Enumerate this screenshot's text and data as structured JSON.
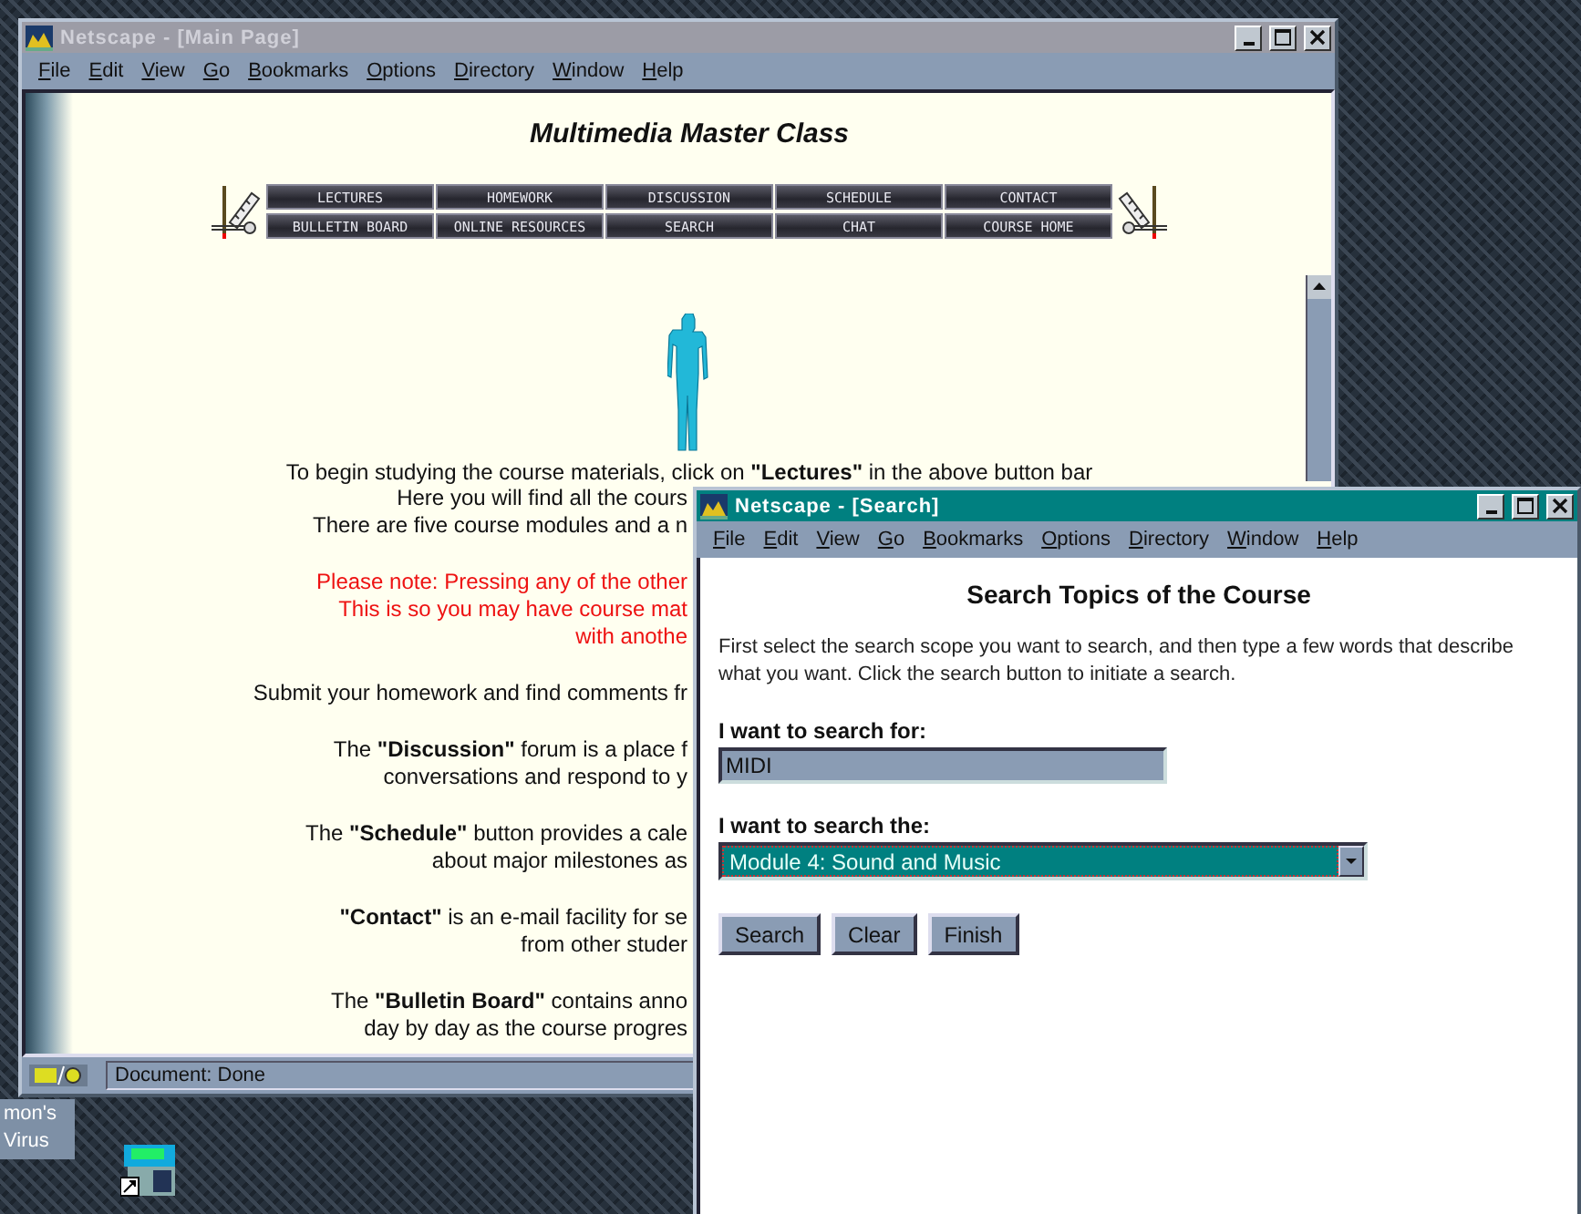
{
  "desktop": {
    "labels": [
      "mon's Virus"
    ]
  },
  "main_window": {
    "title": "Netscape - [Main Page]",
    "active": false,
    "menu": [
      "File",
      "Edit",
      "View",
      "Go",
      "Bookmarks",
      "Options",
      "Directory",
      "Window",
      "Help"
    ],
    "heading": "Multimedia Master Class",
    "nav_buttons": [
      "LECTURES",
      "HOMEWORK",
      "DISCUSSION",
      "SCHEDULE",
      "CONTACT",
      "BULLETIN BOARD",
      "ONLINE RESOURCES",
      "SEARCH",
      "CHAT",
      "COURSE HOME"
    ],
    "intro": "To begin studying the course materials, click on **\"Lectures\"** in the above button bar",
    "paragraphs": [
      {
        "kind": "normal",
        "lines": [
          "Here you will find all the cours",
          "There are five course modules and a n"
        ]
      },
      {
        "kind": "note",
        "lines": [
          "Please note: Pressing any of the other",
          "This is so you may have course mat",
          "with anothe"
        ]
      },
      {
        "kind": "normal",
        "lines": [
          "Submit your homework and find comments fr"
        ]
      },
      {
        "kind": "normal",
        "lines": [
          "The **\"Discussion\"** forum is a place f",
          "conversations and respond to y"
        ]
      },
      {
        "kind": "normal",
        "lines": [
          "The **\"Schedule\"** button provides a cale",
          "about major milestones as"
        ]
      },
      {
        "kind": "normal",
        "lines": [
          "**\"Contact\"** is an e-mail facility for se",
          "from other studer"
        ]
      },
      {
        "kind": "normal",
        "lines": [
          "The **\"Bulletin Board\"** contains anno",
          "day by day as the course progres"
        ]
      }
    ],
    "status": "Document: Done"
  },
  "search_window": {
    "title": "Netscape - [Search]",
    "active": true,
    "menu": [
      "File",
      "Edit",
      "View",
      "Go",
      "Bookmarks",
      "Options",
      "Directory",
      "Window",
      "Help"
    ],
    "heading": "Search Topics of the Course",
    "description": "First select the search scope you want to search, and then type a few words that describe what you want. Click the search button to initiate a search.",
    "query_label": "I want to search for:",
    "query_value": "MIDI",
    "scope_label": "I want to search the:",
    "scope_value": "Module 4: Sound and Music",
    "buttons": [
      "Search",
      "Clear",
      "Finish"
    ]
  }
}
